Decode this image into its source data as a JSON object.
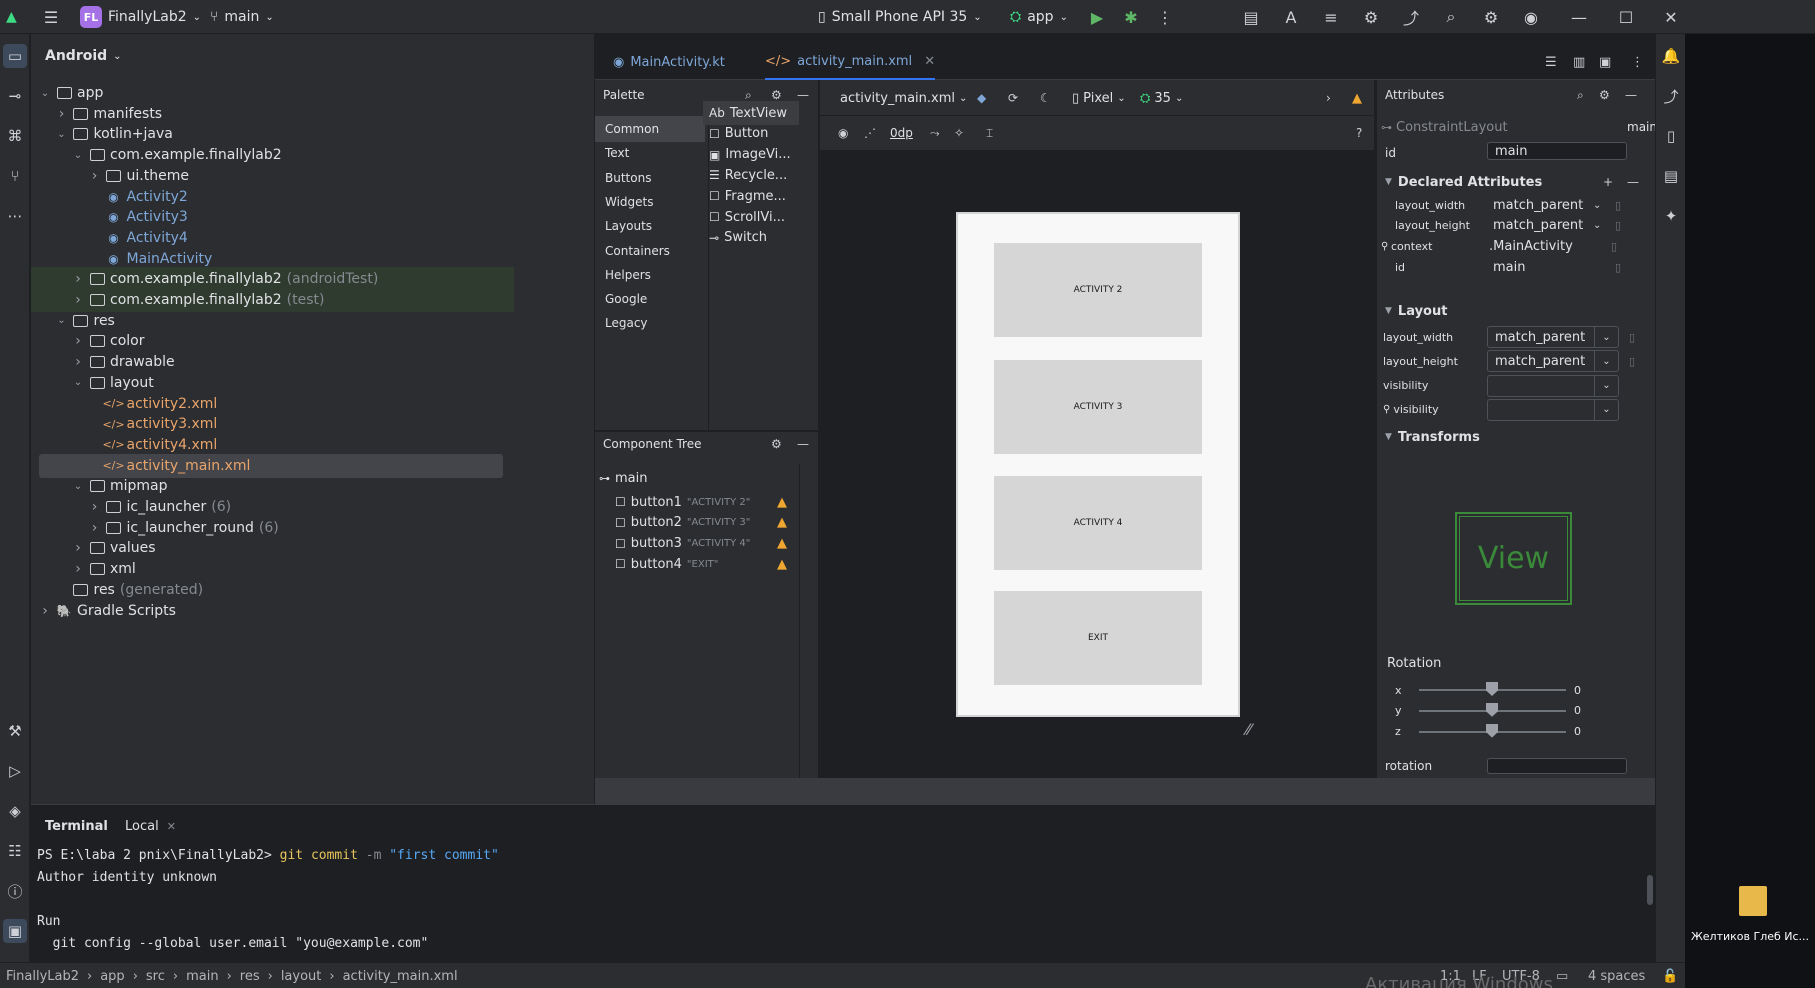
{
  "titlebar": {
    "project_badge": "FL",
    "project_name": "FinallyLab2",
    "branch": "main",
    "device": "Small Phone API 35",
    "run_config": "app"
  },
  "project_panel": {
    "view_mode": "Android",
    "tree": [
      {
        "label": "app",
        "extra": "",
        "type": "module",
        "depth": 0,
        "expanded": true
      },
      {
        "label": "manifests",
        "extra": "",
        "type": "folder",
        "depth": 1,
        "expanded": false
      },
      {
        "label": "kotlin+java",
        "extra": "",
        "type": "folder",
        "depth": 1,
        "expanded": true
      },
      {
        "label": "com.example.finallylab2",
        "extra": "",
        "type": "folder",
        "depth": 2,
        "expanded": true
      },
      {
        "label": "ui.theme",
        "extra": "",
        "type": "folder",
        "depth": 3,
        "expanded": false
      },
      {
        "label": "Activity2",
        "extra": "",
        "type": "kotlin",
        "depth": 3
      },
      {
        "label": "Activity3",
        "extra": "",
        "type": "kotlin",
        "depth": 3
      },
      {
        "label": "Activity4",
        "extra": "",
        "type": "kotlin",
        "depth": 3
      },
      {
        "label": "MainActivity",
        "extra": "",
        "type": "kotlin",
        "depth": 3
      },
      {
        "label": "com.example.finallylab2",
        "extra": "(androidTest)",
        "type": "folder-test",
        "depth": 2,
        "expanded": false
      },
      {
        "label": "com.example.finallylab2",
        "extra": "(test)",
        "type": "folder-test",
        "depth": 2,
        "expanded": false
      },
      {
        "label": "res",
        "extra": "",
        "type": "folder",
        "depth": 1,
        "expanded": true
      },
      {
        "label": "color",
        "extra": "",
        "type": "folder",
        "depth": 2,
        "expanded": false
      },
      {
        "label": "drawable",
        "extra": "",
        "type": "folder",
        "depth": 2,
        "expanded": false
      },
      {
        "label": "layout",
        "extra": "",
        "type": "folder",
        "depth": 2,
        "expanded": true
      },
      {
        "label": "activity2.xml",
        "extra": "",
        "type": "xml",
        "depth": 3
      },
      {
        "label": "activity3.xml",
        "extra": "",
        "type": "xml",
        "depth": 3
      },
      {
        "label": "activity4.xml",
        "extra": "",
        "type": "xml",
        "depth": 3
      },
      {
        "label": "activity_main.xml",
        "extra": "",
        "type": "xml-selected",
        "depth": 3
      },
      {
        "label": "mipmap",
        "extra": "",
        "type": "folder",
        "depth": 2,
        "expanded": true
      },
      {
        "label": "ic_launcher",
        "extra": "(6)",
        "type": "folder",
        "depth": 3,
        "expanded": false
      },
      {
        "label": "ic_launcher_round",
        "extra": "(6)",
        "type": "folder",
        "depth": 3,
        "expanded": false
      },
      {
        "label": "values",
        "extra": "",
        "type": "folder",
        "depth": 2,
        "expanded": false
      },
      {
        "label": "xml",
        "extra": "",
        "type": "folder",
        "depth": 2,
        "expanded": false
      },
      {
        "label": "res",
        "extra": "(generated)",
        "type": "folder-leaf",
        "depth": 1
      },
      {
        "label": "Gradle Scripts",
        "extra": "",
        "type": "gradle",
        "depth": 0,
        "expanded": false
      }
    ]
  },
  "editor_tabs": [
    {
      "label": "MainActivity.kt",
      "active": false
    },
    {
      "label": "activity_main.xml",
      "active": true
    }
  ],
  "palette": {
    "title": "Palette",
    "categories": [
      "Common",
      "Text",
      "Buttons",
      "Widgets",
      "Layouts",
      "Containers",
      "Helpers",
      "Google",
      "Legacy"
    ],
    "selected_category": "Common",
    "items": [
      {
        "icon": "Ab",
        "label": "TextView"
      },
      {
        "icon": "☐",
        "label": "Button"
      },
      {
        "icon": "▣",
        "label": "ImageVi..."
      },
      {
        "icon": "☰",
        "label": "Recycle..."
      },
      {
        "icon": "☐",
        "label": "Fragme..."
      },
      {
        "icon": "☐",
        "label": "ScrollVi..."
      },
      {
        "icon": "⊸",
        "label": "Switch"
      }
    ]
  },
  "component_tree": {
    "title": "Component Tree",
    "root": "main",
    "children": [
      {
        "id": "button1",
        "text": "\"ACTIVITY 2\""
      },
      {
        "id": "button2",
        "text": "\"ACTIVITY 3\""
      },
      {
        "id": "button3",
        "text": "\"ACTIVITY 4\""
      },
      {
        "id": "button4",
        "text": "\"EXIT\""
      }
    ]
  },
  "design_toolbar": {
    "file": "activity_main.xml",
    "device": "Pixel",
    "api": "35",
    "margin": "0dp"
  },
  "preview": {
    "buttons": [
      "ACTIVITY 2",
      "ACTIVITY 3",
      "ACTIVITY 4",
      "EXIT"
    ]
  },
  "attributes": {
    "title": "Attributes",
    "component": "ConstraintLayout",
    "component_id": "main",
    "id_label": "id",
    "id_value": "main",
    "declared_title": "Declared Attributes",
    "declared": [
      {
        "name": "layout_width",
        "value": "match_parent"
      },
      {
        "name": "layout_height",
        "value": "match_parent"
      },
      {
        "name": "context",
        "value": ".MainActivity"
      },
      {
        "name": "id",
        "value": "main"
      }
    ],
    "layout_title": "Layout",
    "layout": [
      {
        "name": "layout_width",
        "value": "match_parent"
      },
      {
        "name": "layout_height",
        "value": "match_parent"
      },
      {
        "name": "visibility",
        "value": ""
      },
      {
        "name": "visibility",
        "value": ""
      }
    ],
    "transforms_title": "Transforms",
    "view_preview": "View",
    "rotation_title": "Rotation",
    "rotation": [
      {
        "axis": "x",
        "value": "0"
      },
      {
        "axis": "y",
        "value": "0"
      },
      {
        "axis": "z",
        "value": "0"
      }
    ],
    "rotation_label": "rotation"
  },
  "terminal": {
    "tabs": [
      "Terminal",
      "Local"
    ],
    "prompt": "PS E:\\laba 2 pnix\\FinallyLab2>",
    "command": "git commit",
    "flag": "-m",
    "message": "\"first commit\"",
    "line2": "Author identity unknown",
    "line3": "Run",
    "line4": "  git config --global user.email \"you@example.com\""
  },
  "statusbar": {
    "breadcrumbs": [
      "FinallyLab2",
      "app",
      "src",
      "main",
      "res",
      "layout",
      "activity_main.xml"
    ],
    "position": "1:1",
    "line_sep": "LF",
    "encoding": "UTF-8",
    "indent": "4 spaces"
  },
  "desktop": {
    "folder_label": "Желтиков Глеб Ис...",
    "watermark": "Активация Windows"
  }
}
